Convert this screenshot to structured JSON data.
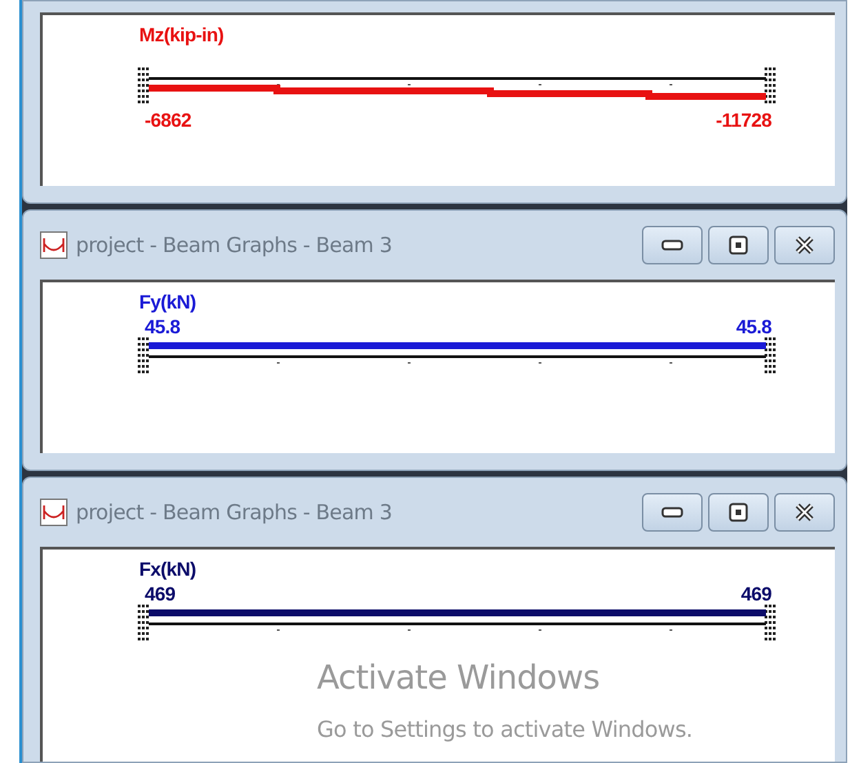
{
  "windows": [
    {
      "graph": {
        "label": "Mz(kip-in)",
        "color": "#e81212",
        "kind": "stepped",
        "start_value": "-6862",
        "end_value": "-11728"
      }
    },
    {
      "title": "project - Beam Graphs - Beam 3",
      "graph": {
        "label": "Fy(kN)",
        "color": "#1a1ad6",
        "kind": "uniform",
        "start_value": "45.8",
        "end_value": "45.8"
      }
    },
    {
      "title": "project - Beam Graphs - Beam 3",
      "graph": {
        "label": "Fx(kN)",
        "color": "#0c0c6a",
        "kind": "uniform",
        "start_value": "469",
        "end_value": "469"
      }
    }
  ],
  "activation_notice": {
    "title": "Activate Windows",
    "subtitle": "Go to Settings to activate Windows."
  }
}
